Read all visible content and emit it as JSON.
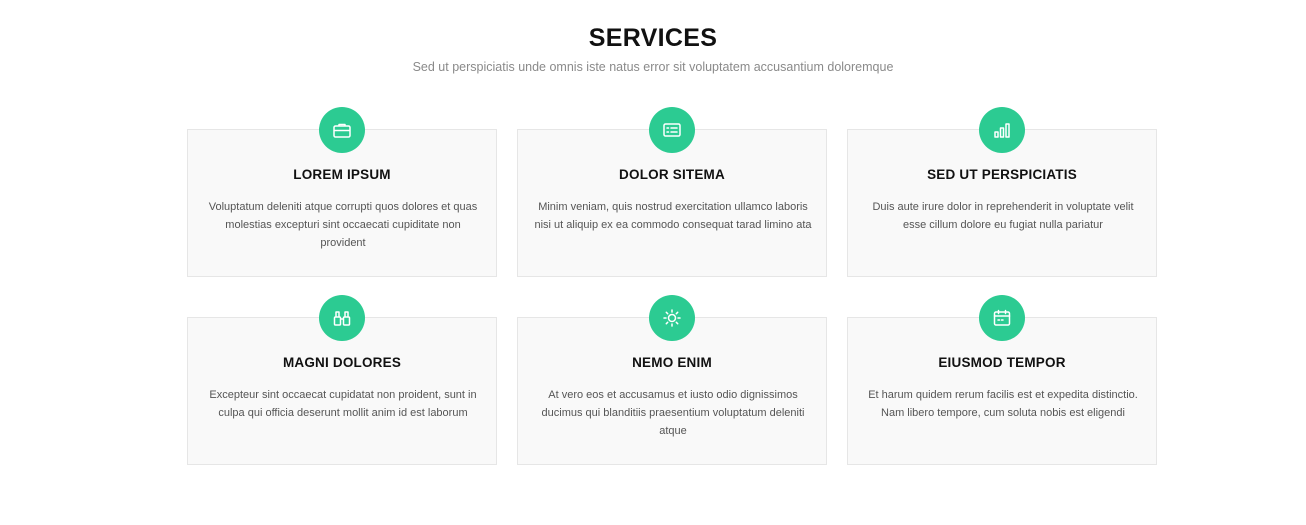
{
  "section": {
    "title": "SERVICES",
    "subtitle": "Sed ut perspiciatis unde omnis iste natus error sit voluptatem accusantium doloremque"
  },
  "accent_color": "#2ccb92",
  "services": [
    {
      "icon": "briefcase-icon",
      "title": "LOREM IPSUM",
      "text": "Voluptatum deleniti atque corrupti quos dolores et quas molestias excepturi sint occaecati cupiditate non provident"
    },
    {
      "icon": "card-checklist-icon",
      "title": "DOLOR SITEMA",
      "text": "Minim veniam, quis nostrud exercitation ullamco laboris nisi ut aliquip ex ea commodo consequat tarad limino ata"
    },
    {
      "icon": "bar-chart-icon",
      "title": "SED UT PERSPICIATIS",
      "text": "Duis aute irure dolor in reprehenderit in voluptate velit esse cillum dolore eu fugiat nulla pariatur"
    },
    {
      "icon": "binoculars-icon",
      "title": "MAGNI DOLORES",
      "text": "Excepteur sint occaecat cupidatat non proident, sunt in culpa qui officia deserunt mollit anim id est laborum"
    },
    {
      "icon": "brightness-icon",
      "title": "NEMO ENIM",
      "text": "At vero eos et accusamus et iusto odio dignissimos ducimus qui blanditiis praesentium voluptatum deleniti atque"
    },
    {
      "icon": "calendar-icon",
      "title": "EIUSMOD TEMPOR",
      "text": "Et harum quidem rerum facilis est et expedita distinctio. Nam libero tempore, cum soluta nobis est eligendi"
    }
  ]
}
